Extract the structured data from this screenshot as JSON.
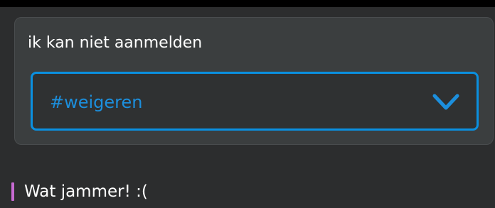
{
  "prompt_card": {
    "title": "ik kan niet aanmelden",
    "dropdown": {
      "selected_value": "#weigeren",
      "icon": "chevron-down-icon",
      "accent_color": "#0a90e0"
    }
  },
  "message": {
    "text": "Wat jammer! :(",
    "quote_bar_color": "#c76ad2"
  }
}
